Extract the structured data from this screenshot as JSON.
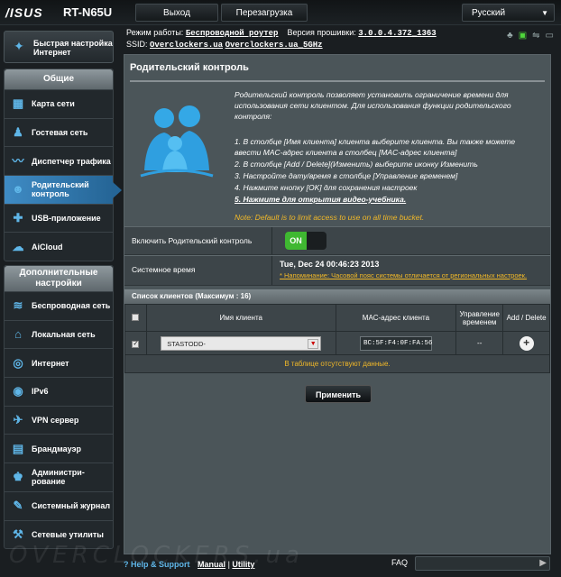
{
  "header": {
    "brand": "/ISUS",
    "model": "RT-N65U",
    "logout_label": "Выход",
    "reboot_label": "Перезагрузка",
    "language": "Русский"
  },
  "info": {
    "mode_label": "Режим работы:",
    "mode_value": "Беспроводной роутер",
    "firmware_label": "Версия прошивки:",
    "firmware_value": "3.0.0.4.372_1363",
    "ssid_label": "SSID:",
    "ssid_1": "Overclockers.ua",
    "ssid_2": "Overclockers.ua_5GHz"
  },
  "sidebar": {
    "quick_setup": "Быстрая настройка Интернет",
    "general_header": "Общие",
    "general_items": [
      {
        "label": "Карта сети",
        "icon": "network-map-icon"
      },
      {
        "label": "Гостевая сеть",
        "icon": "guest-network-icon"
      },
      {
        "label": "Диспетчер трафика",
        "icon": "traffic-manager-icon"
      },
      {
        "label": "Родительский контроль",
        "icon": "parental-control-icon"
      },
      {
        "label": "USB-приложение",
        "icon": "usb-icon"
      },
      {
        "label": "AiCloud",
        "icon": "cloud-icon"
      }
    ],
    "advanced_header": "Дополнительные настройки",
    "advanced_items": [
      {
        "label": "Беспроводная сеть",
        "icon": "wireless-icon"
      },
      {
        "label": "Локальная сеть",
        "icon": "lan-icon"
      },
      {
        "label": "Интернет",
        "icon": "globe-icon"
      },
      {
        "label": "IPv6",
        "icon": "ipv6-icon"
      },
      {
        "label": "VPN сервер",
        "icon": "vpn-icon"
      },
      {
        "label": "Брандмауэр",
        "icon": "firewall-icon"
      },
      {
        "label": "Администри-рование",
        "icon": "admin-icon"
      },
      {
        "label": "Системный журнал",
        "icon": "log-icon"
      },
      {
        "label": "Сетевые утилиты",
        "icon": "tools-icon"
      }
    ]
  },
  "main": {
    "title": "Родительский контроль",
    "description": "Родительский контроль позволяет установить ограничение времени для использования сети клиентом. Для использования функции родительского контроля:",
    "steps": [
      "1.  В столбце [Имя клиента] клиента выберите клиента. Вы также можете ввести MAC-адрес клиента в столбец [MAC-адрес клиента]",
      "2.  В столбце [Add / Delete](Изменить) выберите иконку Изменить",
      "3.  Настройте дату/время в столбце [Управление временем]",
      "4.  Нажмите кнопку [OK] для сохранения настроек",
      "5.  Нажмите для открытия видео-учебника."
    ],
    "note": "Note: Default is to limit access to use on all time bucket.",
    "enable_label": "Включить Родительский контроль",
    "toggle_state": "ON",
    "systime_label": "Системное время",
    "systime_value": "Tue, Dec 24 00:46:23 2013",
    "systime_note": "* Напоминание: Часовой пояс системы отличается от региональных настроек.",
    "list_title": "Список клиентов (Максимум : 16)",
    "col_name": "Имя клиента",
    "col_mac": "MAC-адрес клиента",
    "col_time": "Управление временем",
    "col_add": "Add / Delete",
    "row_client": "STASTODD-",
    "row_mac": "BC:5F:F4:0F:FA:56",
    "row_time": "--",
    "empty_text": "В таблице отсутствуют данные.",
    "apply_label": "Применить"
  },
  "footer": {
    "help": "Help & Support",
    "manual": "Manual",
    "sep": "|",
    "utility": "Utility",
    "faq": "FAQ",
    "watermark": "OVERCLOCKERS.ua"
  }
}
